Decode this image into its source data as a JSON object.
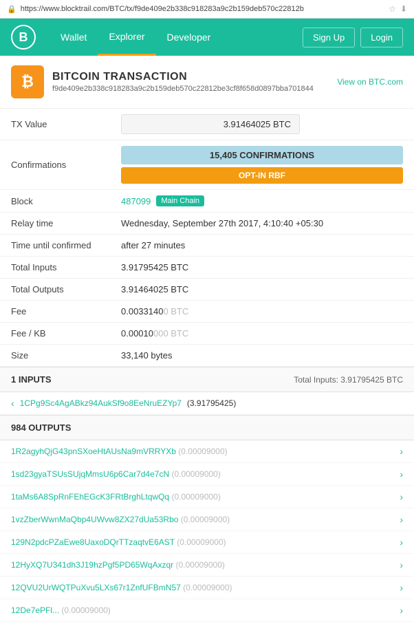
{
  "addressBar": {
    "url": "https://www.blocktrail.com/BTC/tx/f9de409e2b338c918283a9c2b159deb570c22812b"
  },
  "nav": {
    "logo": "B",
    "links": [
      "Wallet",
      "Explorer",
      "Developer"
    ],
    "activeLink": "Explorer",
    "rightButtons": [
      "Sign Up",
      "Login"
    ]
  },
  "transaction": {
    "title": "BITCOIN TRANSACTION",
    "viewLink": "View on BTC.com",
    "hash": "f9de409e2b338c918283a9c2b159deb570c22812be3cf8f658d0897bba701844",
    "txValue": "3.91464025 BTC",
    "confirmations": "15,405 CONFIRMATIONS",
    "rbf": "OPT-IN RBF",
    "block": "487099",
    "blockBadge": "Main Chain",
    "relayTime": "Wednesday, September 27th 2017, 4:10:40 +05:30",
    "timeUntilConfirmed": "after 27 minutes",
    "totalInputs": "3.91795425 BTC",
    "totalOutputs": "3.91464025 BTC",
    "fee": "0.0033140",
    "feeDim": "0 BTC",
    "feeKb": "0.00010",
    "feeKbDim": "000 BTC",
    "size": "33,140 bytes"
  },
  "inputs": {
    "header": "1 INPUTS",
    "totalLabel": "Total Inputs: 3.91795425 BTC",
    "items": [
      {
        "address": "1CPg9Sc4AgABkz94AukSf9o8EeNruEZYp7",
        "value": "(3.91795425)"
      }
    ]
  },
  "outputs": {
    "header": "984 OUTPUTS",
    "items": [
      {
        "address": "1R2agyhQjG43pnSXoeHtAUsNa9mVRRYXb",
        "value": "(0.00009",
        "valueDim": "000)"
      },
      {
        "address": "1sd23gyaTSUsSUjqMmsU6p6Car7d4e7cN",
        "value": "(0.00009",
        "valueDim": "000)"
      },
      {
        "address": "1taMs6A8SpRnFEhEGcK3FRtBrghLtqwQq",
        "value": "(0.00009",
        "valueDim": "000)"
      },
      {
        "address": "1vzZberWwnMaQbp4UWvw8ZX27dUa53Rbo",
        "value": "(0.00009",
        "valueDim": "000)"
      },
      {
        "address": "129N2pdcPZaEwe8UaxoDQrTTzaqtvE6AST",
        "value": "(0.00009",
        "valueDim": "000)"
      },
      {
        "address": "12HyXQ7U341dh3J19hzPgf5PD65WqAxzqr",
        "value": "(0.00009",
        "valueDim": "000)"
      },
      {
        "address": "12QVU2UrWQTPuXvu5LXs67r1ZnfUFBmN57",
        "value": "(0.00009",
        "valueDim": "000)"
      },
      {
        "address": "12De7ePFl...",
        "value": "(0.00009",
        "valueDim": "000)"
      }
    ]
  }
}
